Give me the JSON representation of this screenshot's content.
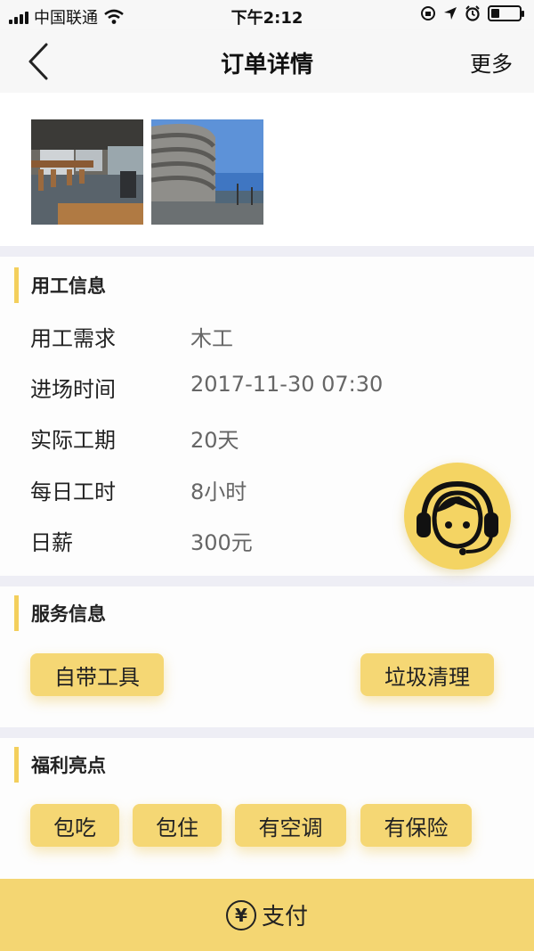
{
  "status_bar": {
    "carrier": "中国联通",
    "time": "下午2:12"
  },
  "nav": {
    "title": "订单详情",
    "more_label": "更多"
  },
  "work_info": {
    "title": "用工信息",
    "rows": [
      {
        "label": "用工需求",
        "value": "木工"
      },
      {
        "label": "进场时间",
        "value": "2017-11-30 07:30"
      },
      {
        "label": "实际工期",
        "value": "20天"
      },
      {
        "label": "每日工时",
        "value": "8小时"
      },
      {
        "label": "日薪",
        "value": "300元"
      }
    ]
  },
  "service_info": {
    "title": "服务信息",
    "tags": [
      "自带工具",
      "垃圾清理"
    ]
  },
  "benefits": {
    "title": "福利亮点",
    "tags": [
      "包吃",
      "包住",
      "有空调",
      "有保险"
    ]
  },
  "pay": {
    "symbol": "¥",
    "label": "支付"
  },
  "colors": {
    "accent": "#f4d672",
    "section_bar": "#f3cf5c",
    "divider": "#eeeef5"
  }
}
